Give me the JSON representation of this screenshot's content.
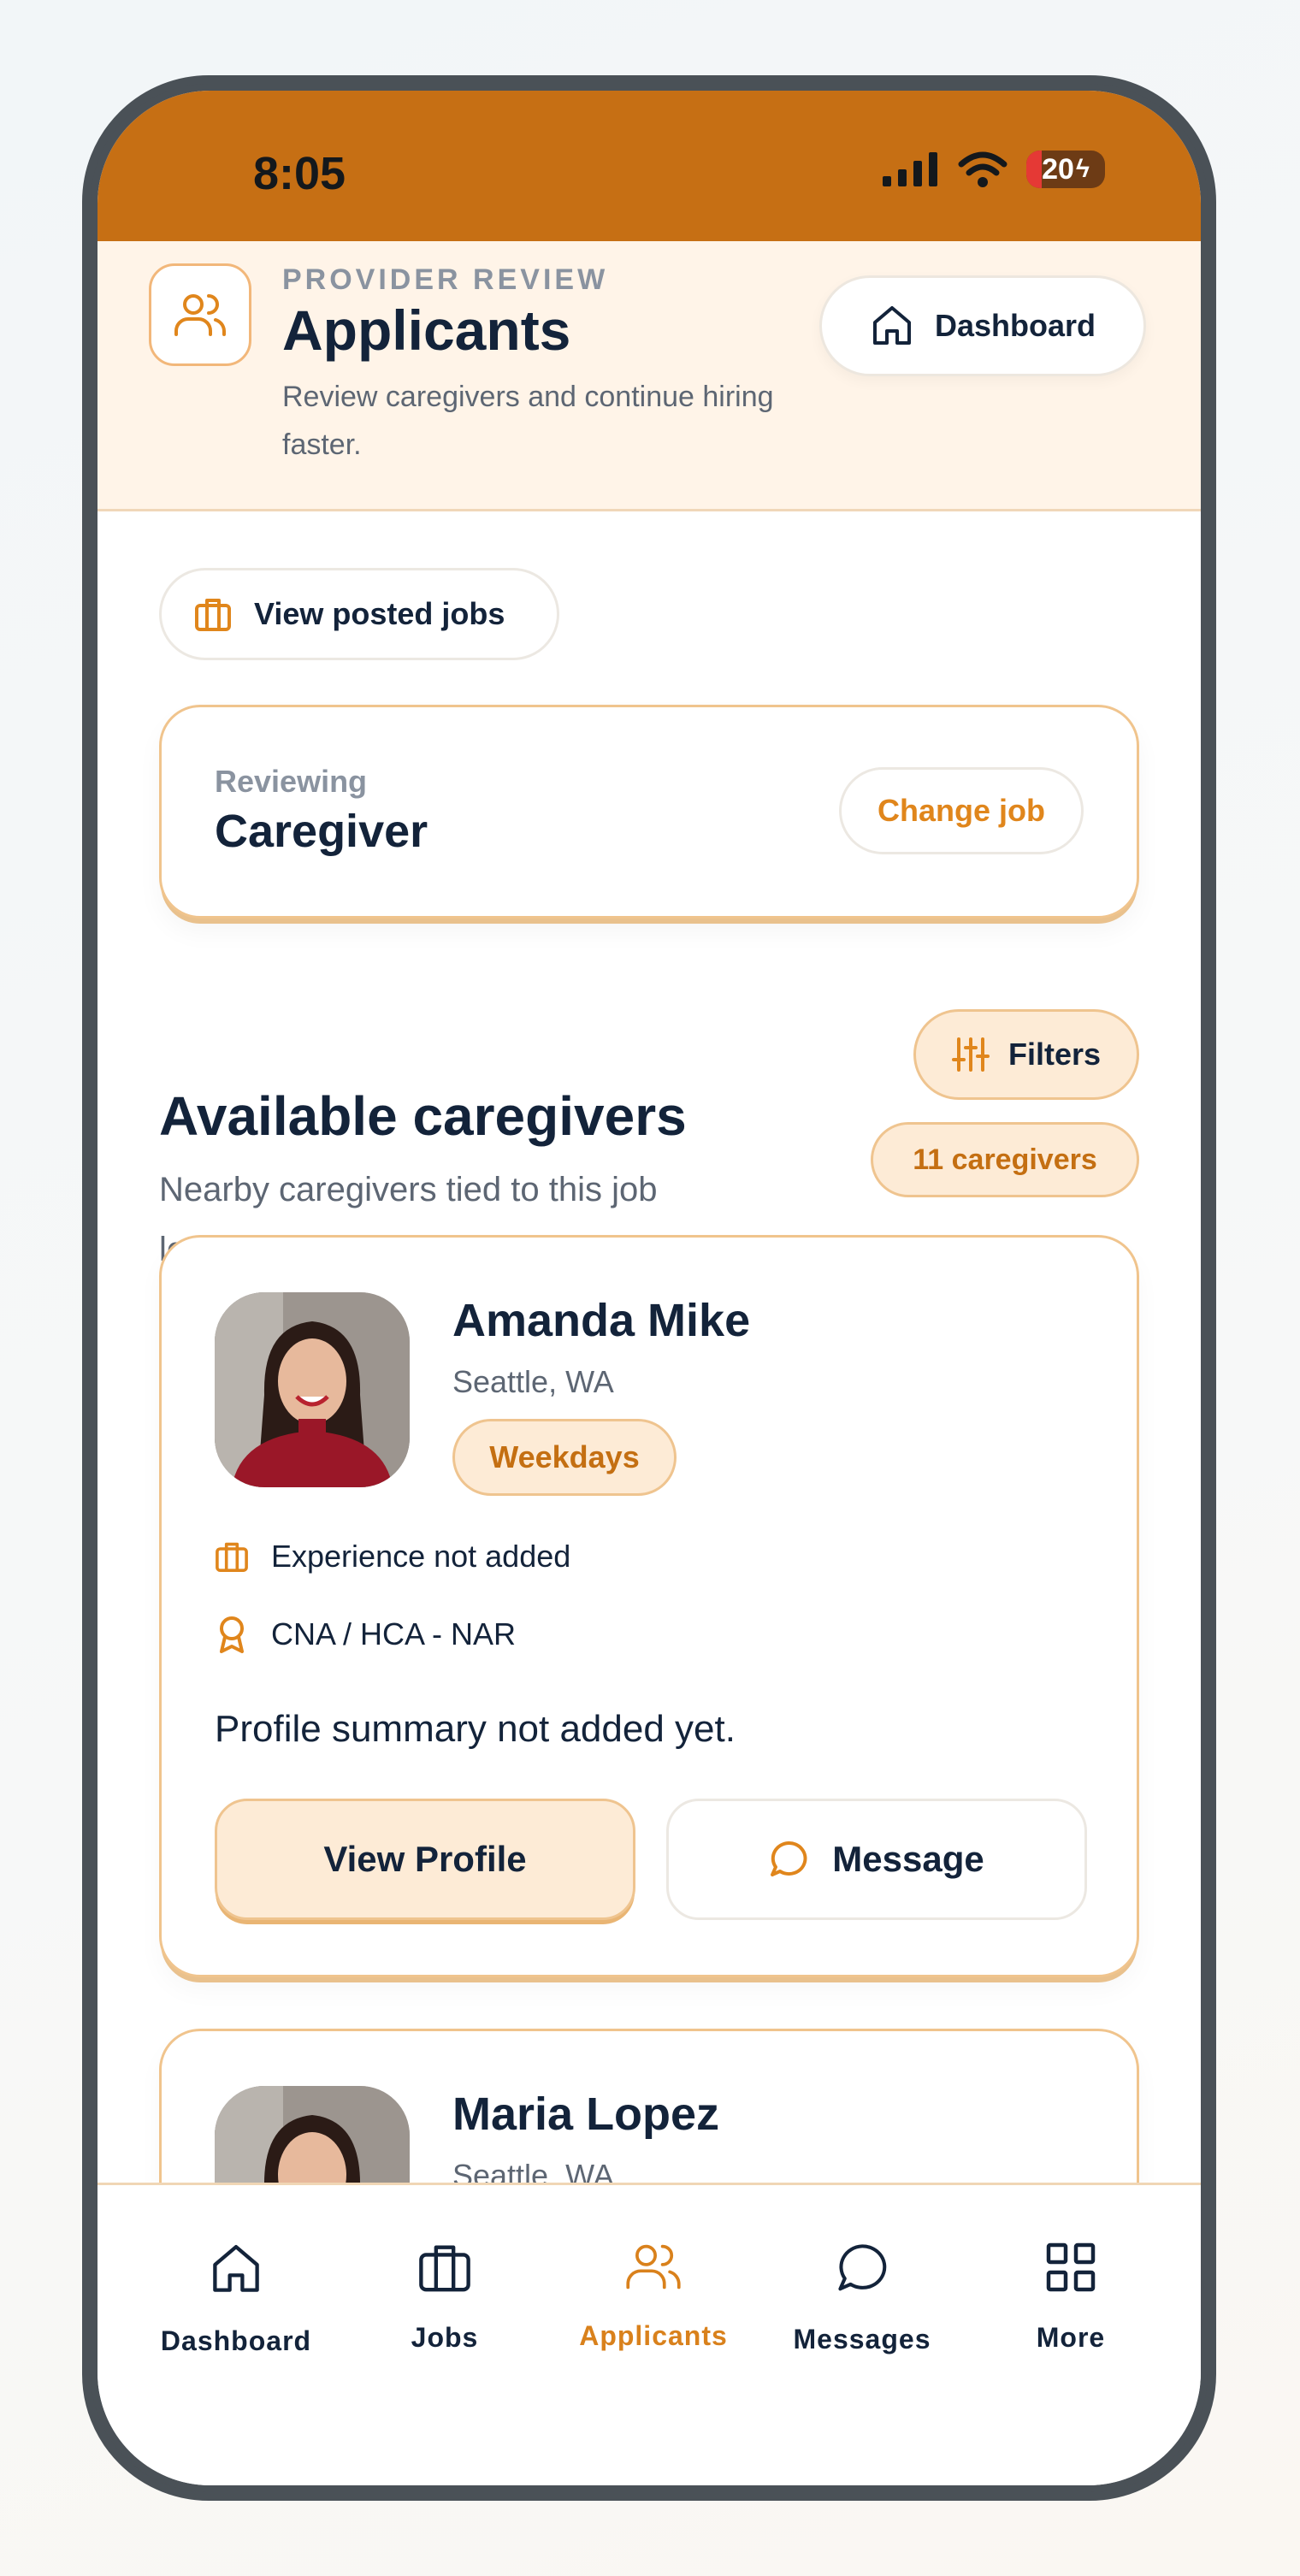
{
  "status_bar": {
    "time": "8:05",
    "battery_label": "20",
    "battery_level_percent": 20
  },
  "header": {
    "eyebrow": "PROVIDER REVIEW",
    "title": "Applicants",
    "subtitle": "Review caregivers and continue hiring faster.",
    "dashboard_button": "Dashboard"
  },
  "view_posted_jobs": "View posted jobs",
  "review_card": {
    "label": "Reviewing",
    "job": "Caregiver",
    "change_button": "Change job"
  },
  "section": {
    "title": "Available caregivers",
    "subtitle": "Nearby caregivers tied to this job location appear here.",
    "filters_button": "Filters",
    "count_badge": "11 caregivers"
  },
  "caregivers": [
    {
      "name": "Amanda Mike",
      "location": "Seattle, WA",
      "availability": "Weekdays",
      "experience": "Experience not added",
      "certification": "CNA / HCA - NAR",
      "summary": "Profile summary not added yet.",
      "view_profile": "View Profile",
      "message": "Message"
    },
    {
      "name": "Maria Lopez",
      "location": "Seattle, WA"
    }
  ],
  "tabbar": {
    "active": "Applicants",
    "items": [
      {
        "label": "Dashboard",
        "icon": "home-icon"
      },
      {
        "label": "Jobs",
        "icon": "briefcase-icon"
      },
      {
        "label": "Applicants",
        "icon": "users-icon"
      },
      {
        "label": "Messages",
        "icon": "chat-bubble-icon"
      },
      {
        "label": "More",
        "icon": "grid-icon"
      }
    ]
  },
  "colors": {
    "accent": "#c66f14",
    "accent_light": "#fdebd6",
    "header_bg": "#fff4e8",
    "text_dark": "#13233a",
    "text_muted": "#5d6673"
  }
}
